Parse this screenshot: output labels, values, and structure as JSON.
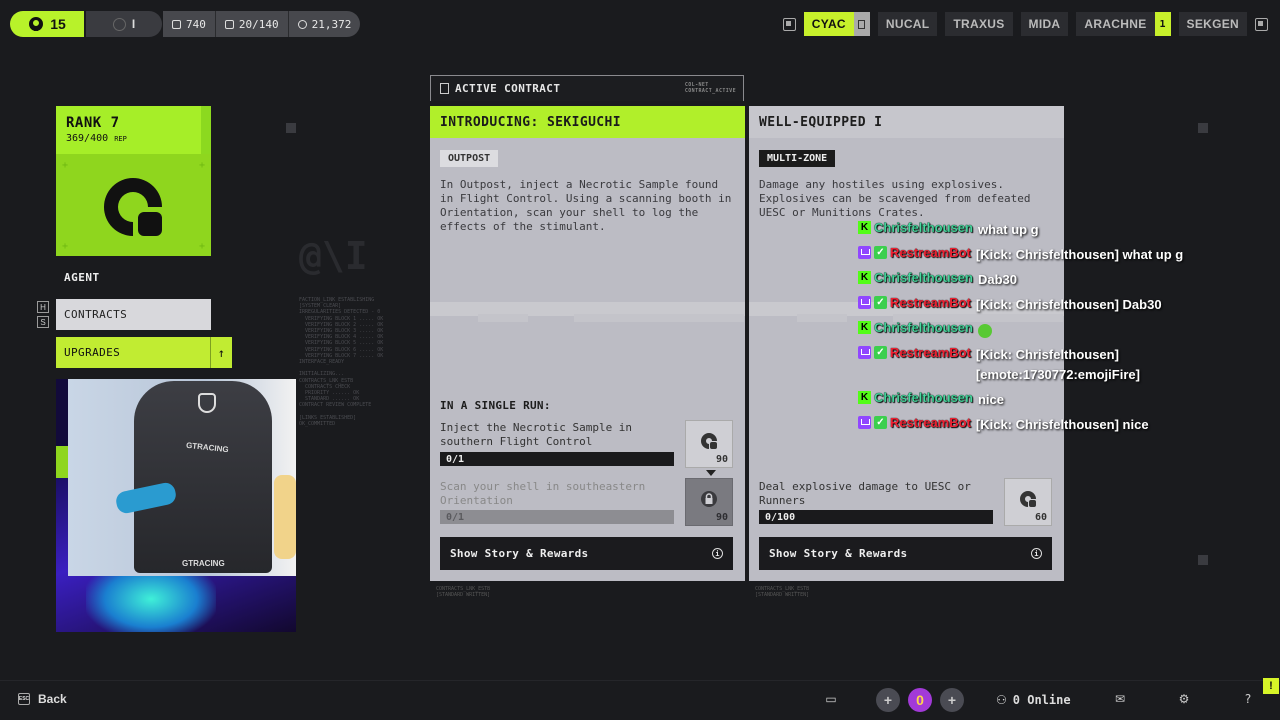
{
  "topbar": {
    "level": "15",
    "prestige": "I",
    "stats": [
      {
        "icon": "crate-icon",
        "value": "740"
      },
      {
        "icon": "list-icon",
        "value": "20/140"
      },
      {
        "icon": "credits-icon",
        "value": "21,372"
      }
    ],
    "factions": [
      {
        "label": "CYAC",
        "active": true
      },
      {
        "label": "NUCAL"
      },
      {
        "label": "TRAXUS"
      },
      {
        "label": "MIDA"
      },
      {
        "label": "ARACHNE",
        "badge": "1"
      },
      {
        "label": "SEKGEN"
      }
    ]
  },
  "sidebar": {
    "rank_title": "RANK 7",
    "rank_rep": "369/400",
    "rank_rep_unit": "REP",
    "agent_label": "AGENT",
    "contracts_label": "CONTRACTS",
    "upgrades_label": "UPGRADES",
    "key_h": "H",
    "key_s": "S",
    "lower_letter": "I"
  },
  "active_contract": {
    "header": "ACTIVE CONTRACT",
    "header_tag": [
      "COL-NET",
      "CONTRACT_ACTIVE"
    ]
  },
  "card1": {
    "title": "INTRODUCING: SEKIGUCHI",
    "tag": "OUTPOST",
    "description": "In Outpost, inject a Necrotic Sample found in Flight Control. Using a scanning booth in Orientation, scan your shell to log the effects of the stimulant.",
    "run_label": "IN A SINGLE RUN:",
    "tasks": [
      {
        "text": "Inject the Necrotic Sample in southern Flight Control",
        "progress": "0/1",
        "reward": "90",
        "locked": false
      },
      {
        "text": "Scan your shell in southeastern Orientation",
        "progress": "0/1",
        "reward": "90",
        "locked": true
      }
    ],
    "button": "Show Story & Rewards",
    "foot_tag": [
      "CONTRACTS_LNK_ESTB",
      "[STANDARD WRITTEN]"
    ]
  },
  "card2": {
    "title": "WELL-EQUIPPED I",
    "tag": "MULTI-ZONE",
    "description": "Damage any hostiles using explosives. Explosives can be scavenged from defeated UESC or Munitions Crates.",
    "tasks": [
      {
        "text": "Deal explosive damage to UESC or Runners",
        "progress": "0/100",
        "reward": "60"
      }
    ],
    "button": "Show Story & Rewards",
    "foot_tag": [
      "CONTRACTS_LNK_ESTB",
      "[STANDARD WRITTEN]"
    ]
  },
  "deco": {
    "glyph": "@\\I",
    "lines": "FACTION_LINK ESTABLISHING\n[SYSTEM CLEAR]\nIRREGULARITIES DETECTED - 0\n  VERIFYING BLOCK 1 ..... OK\n  VERIFYING BLOCK 2 ..... OK\n  VERIFYING BLOCK 3 ..... OK\n  VERIFYING BLOCK 4 ..... OK\n  VERIFYING BLOCK 5 ..... OK\n  VERIFYING BLOCK 6 ..... OK\n  VERIFYING BLOCK 7 ..... OK\nINTERFACE_READY\n\nINITIALIZING...\nCONTRACTS_LNK_ESTB\n  CONTRACTS CHECK\n  PRIORITY ...... OK\n  STANDARD ...... OK\nCONTRACT REVIEW COMPLETE\n\n[LINKS ESTABLISHED]\nOK_COMMITTED"
  },
  "chat": [
    {
      "platform": "kick",
      "user": "Chrisfelthousen",
      "message": "what up g"
    },
    {
      "platform": "twitch",
      "user": "RestreamBot",
      "message": "[Kick: Chrisfelthousen] what up g"
    },
    {
      "platform": "kick",
      "user": "Chrisfelthousen",
      "message": "Dab30"
    },
    {
      "platform": "twitch",
      "user": "RestreamBot",
      "message": "[Kick: Chrisfelthousen] Dab30"
    },
    {
      "platform": "kick",
      "user": "Chrisfelthousen",
      "message": "",
      "emoji": true
    },
    {
      "platform": "twitch",
      "user": "RestreamBot",
      "message": "[Kick: Chrisfelthousen] [emote:1730772:emojiFire]"
    },
    {
      "platform": "kick",
      "user": "Chrisfelthousen",
      "message": "nice"
    },
    {
      "platform": "twitch",
      "user": "RestreamBot",
      "message": "[Kick: Chrisfelthousen] nice"
    }
  ],
  "bottom": {
    "back_label": "Back",
    "back_key": "ESC",
    "online": "0 Online",
    "center_badge": "0",
    "alert": "!"
  },
  "colors": {
    "accent": "#b8f22a",
    "card": "#bcbcc4",
    "background": "#1a1b1e"
  }
}
